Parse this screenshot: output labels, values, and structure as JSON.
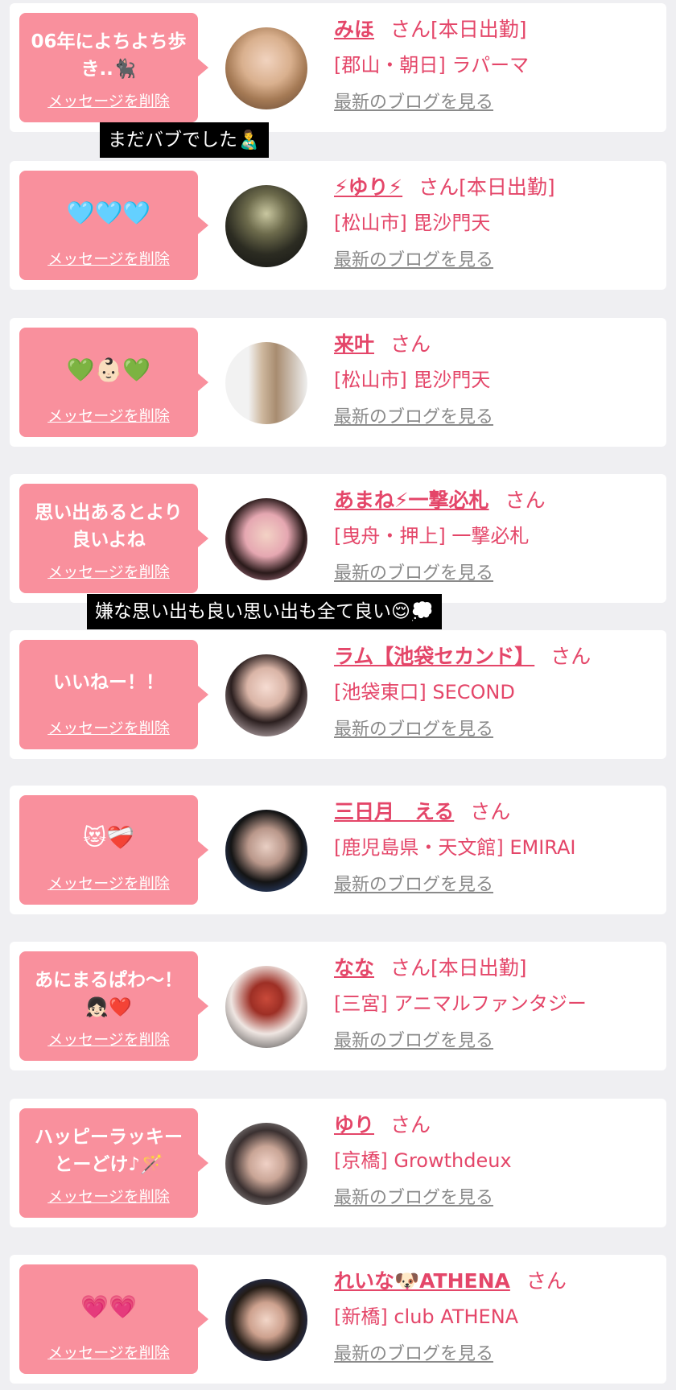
{
  "common": {
    "delete_label": "メッセージを削除",
    "san_suffix": "さん",
    "blog_label": "最新のブログを見る"
  },
  "cards": [
    {
      "message": "06年によちよち歩き..🐈‍⬛",
      "name": "みほ",
      "status": "[本日出勤]",
      "shop": "[郡山・朝日] ラパーマ"
    },
    {
      "message": "🩵🩵🩵",
      "name": "⚡ゆり⚡",
      "status": "[本日出勤]",
      "shop": "[松山市] 毘沙門天"
    },
    {
      "message": "💚👶🏻💚",
      "name": "来叶",
      "status": "",
      "shop": "[松山市] 毘沙門天"
    },
    {
      "message": "思い出あるとより良いよね",
      "name": "あまね⚡一撃必札",
      "status": "",
      "shop": "[曳舟・押上] 一撃必札"
    },
    {
      "message": "いいねー！！",
      "name": "ラム【池袋セカンド】",
      "status": "",
      "shop": "[池袋東口] SECOND"
    },
    {
      "message": "😻❤️‍🩹",
      "name": "三日月　える",
      "status": "",
      "shop": "[鹿児島県・天文館] EMIRAI"
    },
    {
      "message": "あにまるぱわ〜！👧🏻❤️",
      "name": "なな",
      "status": "[本日出勤]",
      "shop": "[三宮] アニマルファンタジー"
    },
    {
      "message": "ハッピーラッキーとーどけ♪🪄",
      "name": "ゆり",
      "status": "",
      "shop": "[京橋] Growthdeux"
    },
    {
      "message": "💗💗",
      "name": "れいな🐶ATHENA",
      "status": "",
      "shop": "[新橋] club ATHENA"
    }
  ],
  "overlays": [
    {
      "text": "まだバブでした👨‍🍼"
    },
    {
      "text": "嫌な思い出も良い思い出も全て良い😌💭"
    }
  ]
}
